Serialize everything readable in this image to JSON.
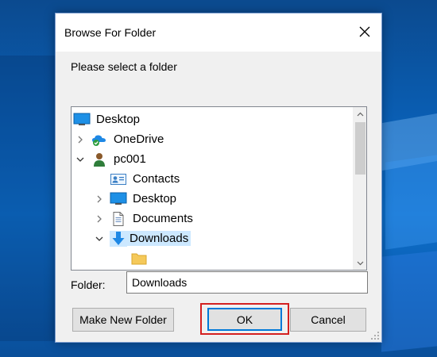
{
  "window": {
    "title": "Browse For Folder"
  },
  "prompt": "Please select a folder",
  "tree": {
    "items": [
      {
        "label": "Desktop",
        "icon": "desktop-icon",
        "expander": "none"
      },
      {
        "label": "OneDrive",
        "icon": "onedrive-icon",
        "expander": "collapsed"
      },
      {
        "label": "pc001",
        "icon": "user-icon",
        "expander": "expanded"
      },
      {
        "label": "Contacts",
        "icon": "contacts-icon",
        "expander": "none"
      },
      {
        "label": "Desktop",
        "icon": "desktop-icon",
        "expander": "collapsed"
      },
      {
        "label": "Documents",
        "icon": "documents-icon",
        "expander": "collapsed"
      },
      {
        "label": "Downloads",
        "icon": "downloads-icon",
        "expander": "expanded",
        "selected": true
      }
    ]
  },
  "folder": {
    "label": "Folder:",
    "value": "Downloads"
  },
  "buttons": {
    "make_new_folder": "Make New Folder",
    "ok": "OK",
    "cancel": "Cancel"
  },
  "colors": {
    "selection": "#cce8ff",
    "focus_border": "#0078d7",
    "highlight_box": "#d42020",
    "dialog_bg": "#f0f0f0"
  }
}
